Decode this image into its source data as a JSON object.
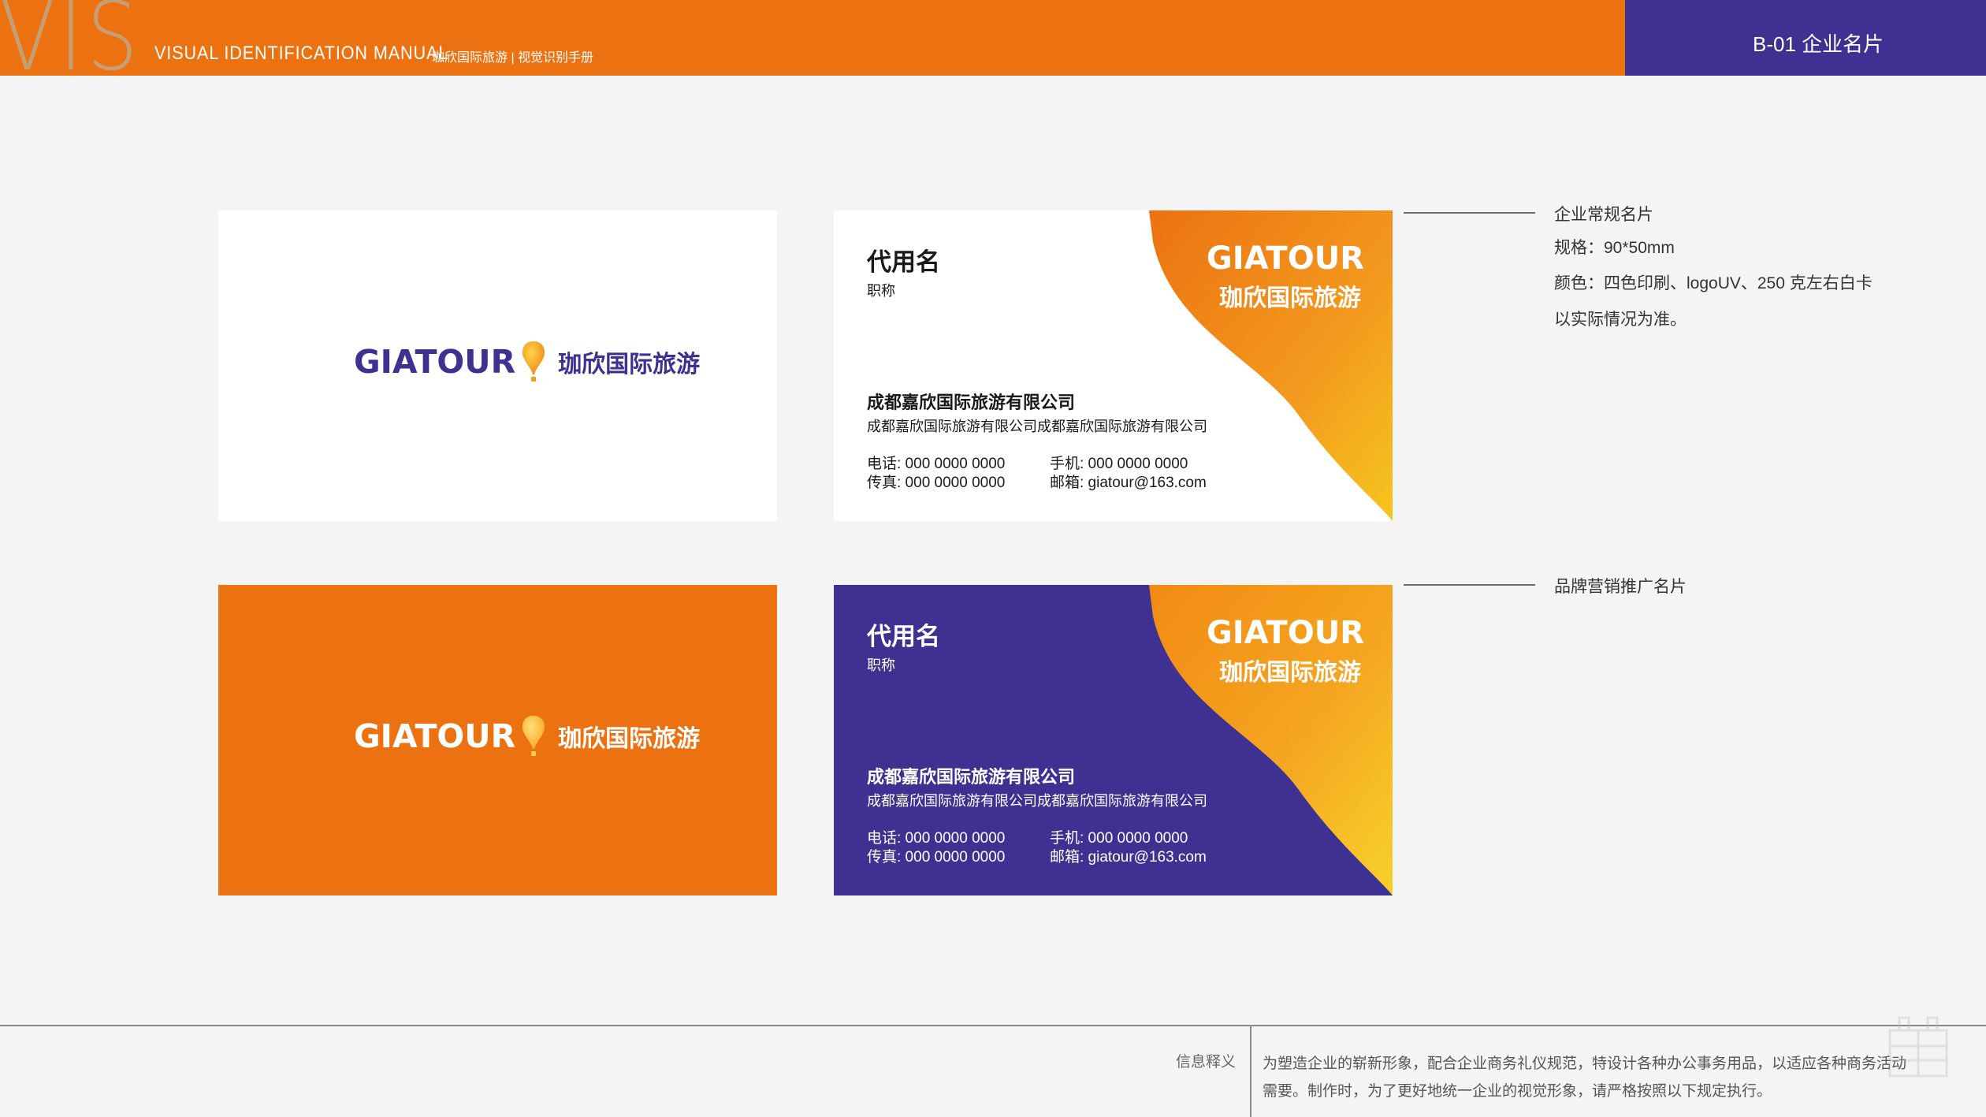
{
  "header": {
    "vis_letters": "VIS",
    "manual_title": "VISUAL IDENTIFICATION MANUAL",
    "manual_subtitle": "珈欣国际旅游 | 视觉识别手册",
    "section_label": "B-01 企业名片",
    "colors": {
      "orange": "#ec7211",
      "purple": "#3f3191",
      "vis_tint": "#c79d72"
    }
  },
  "brand": {
    "logo_en": "GIATOUR",
    "logo_cn": "珈欣国际旅游",
    "logo_en_color_dark": "#3e3192",
    "logo_en_color_accent": "#ec7211",
    "balloon_icon": "hot-air-balloon-icon"
  },
  "card_fields": {
    "name": "代用名",
    "title": "职称",
    "company": "成都嘉欣国际旅游有限公司",
    "address": "成都嘉欣国际旅游有限公司成都嘉欣国际旅游有限公司",
    "phone": "电话: 000 0000 0000",
    "fax": "传真: 000 0000 0000",
    "mobile": "手机: 000 0000 0000",
    "email": "邮箱: giatour@163.com"
  },
  "annotations": {
    "standard": {
      "title": "企业常规名片",
      "spec": "规格：90*50mm",
      "color": "颜色：四色印刷、logoUV、250 克左右白卡",
      "note": "以实际情况为准。"
    },
    "promo": {
      "title": "品牌营销推广名片"
    }
  },
  "footer": {
    "label": "信息释义",
    "description": "为塑造企业的崭新形象，配合企业商务礼仪规范，特设计各种办公事务用品，以适应各种商务活动需要。制作时，为了更好地统一企业的视觉形象，请严格按照以下规定执行。"
  }
}
